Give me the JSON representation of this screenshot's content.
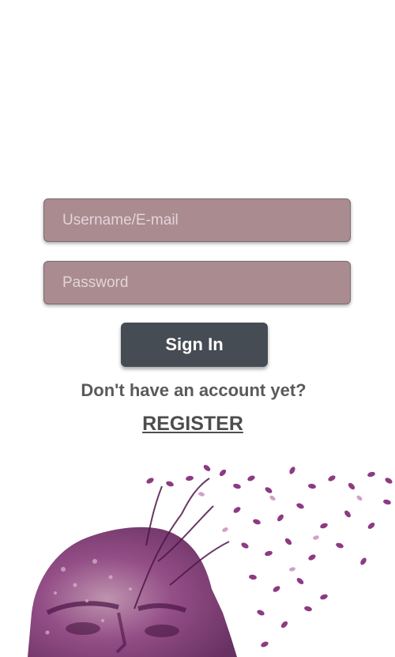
{
  "login_form": {
    "username_placeholder": "Username/E-mail",
    "password_placeholder": "Password",
    "signin_label": "Sign In"
  },
  "register_prompt": {
    "question": "Don't have an account yet?",
    "link_label": "REGISTER"
  },
  "colors": {
    "field_fill": "#a98b90",
    "button_fill": "#464c53",
    "art_purple": "#7a2d6f"
  }
}
